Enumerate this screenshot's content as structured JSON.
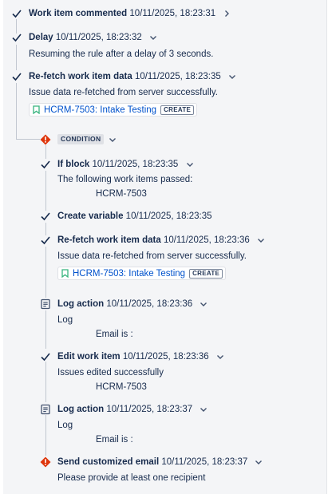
{
  "items": [
    {
      "title": "Work item commented",
      "time": "10/11/2025, 18:23:31",
      "icon": "check-icon",
      "chevron": "chevron-right-icon"
    },
    {
      "title": "Delay",
      "time": "10/11/2025, 18:23:32",
      "icon": "check-icon",
      "chevron": "chevron-down-icon",
      "lines": [
        "Resuming the rule after a delay of 3 seconds."
      ]
    },
    {
      "title": "Re-fetch work item data",
      "time": "10/11/2025, 18:23:35",
      "icon": "check-icon",
      "chevron": "chevron-down-icon",
      "lines": [
        "Issue data re-fetched from server successfully."
      ],
      "issue": {
        "key": "HCRM-7503: Intake Testing",
        "badge": "CREATE"
      }
    }
  ],
  "condition": {
    "label": "CONDITION",
    "icon": "error-icon"
  },
  "nested": [
    {
      "title": "If block",
      "time": "10/11/2025, 18:23:35",
      "icon": "check-icon",
      "lines": [
        "The following work items passed:"
      ],
      "indented": [
        "HCRM-7503"
      ]
    },
    {
      "title": "Create variable",
      "time": "10/11/2025, 18:23:35",
      "icon": "check-icon"
    },
    {
      "title": "Re-fetch work item data",
      "time": "10/11/2025, 18:23:36",
      "icon": "check-icon",
      "lines": [
        "Issue data re-fetched from server successfully."
      ],
      "issue": {
        "key": "HCRM-7503: Intake Testing",
        "badge": "CREATE"
      }
    },
    {
      "title": "Log action",
      "time": "10/11/2025, 18:23:36",
      "icon": "log-icon",
      "lines": [
        "Log"
      ],
      "indented": [
        "Email is :"
      ]
    },
    {
      "title": "Edit work item",
      "time": "10/11/2025, 18:23:36",
      "icon": "check-icon",
      "lines": [
        "Issues edited successfully"
      ],
      "indented": [
        "HCRM-7503"
      ]
    },
    {
      "title": "Log action",
      "time": "10/11/2025, 18:23:37",
      "icon": "log-icon",
      "lines": [
        "Log"
      ],
      "indented": [
        "Email is :"
      ]
    },
    {
      "title": "Send customized email",
      "time": "10/11/2025, 18:23:37",
      "icon": "error-icon",
      "lines": [
        "Please provide at least one recipient"
      ]
    }
  ],
  "colors": {
    "success": "#172b4d",
    "error": "#de350b",
    "link": "#0052cc",
    "bookmark": "#36b37e"
  }
}
